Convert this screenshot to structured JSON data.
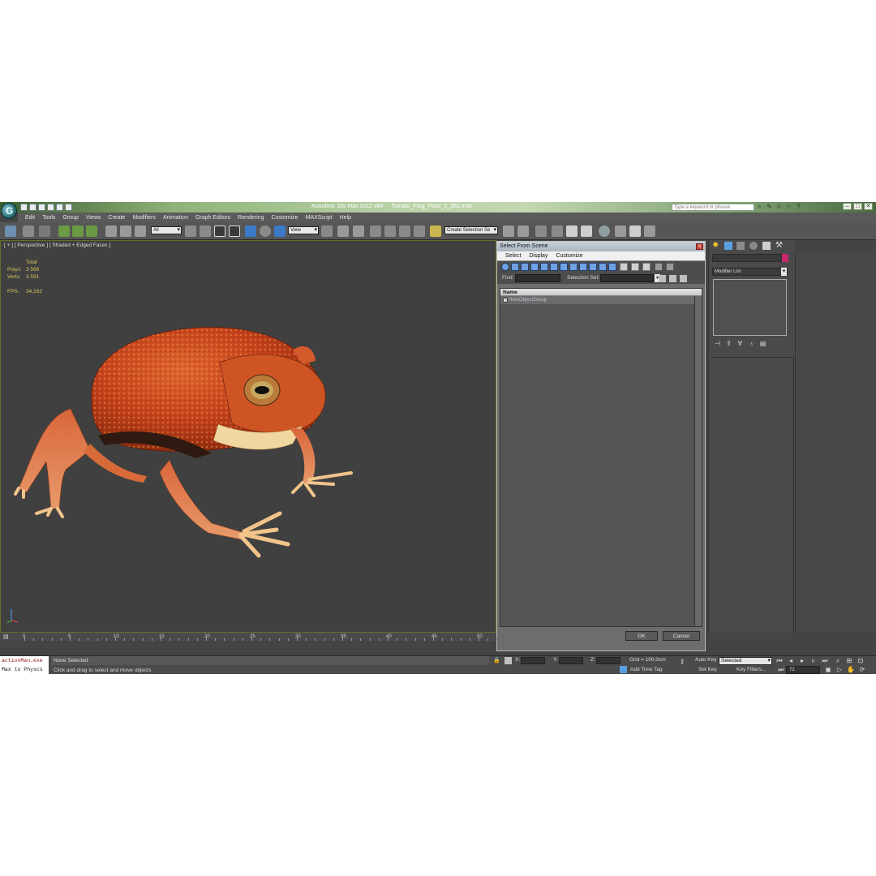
{
  "window": {
    "app_title": "Autodesk 3ds Max  2012 x64",
    "file_name": "Tomato_Frog_Pose_2_361.max",
    "search_placeholder": "Type a keyword or phrase",
    "controls": [
      "–",
      "□",
      "✕"
    ],
    "title_icons": [
      "binoculars-icon",
      "wrench-icon",
      "star-icon",
      "help-icon"
    ]
  },
  "menu": [
    "Edit",
    "Tools",
    "Group",
    "Views",
    "Create",
    "Modifiers",
    "Animation",
    "Graph Editors",
    "Rendering",
    "Customize",
    "MAXScript",
    "Help"
  ],
  "toolbar": {
    "filter_value": "All",
    "ref_coord_value": "View",
    "selection_set_value": "Create Selection Se"
  },
  "viewport": {
    "label": "[ + ] [ Perspective ] [ Shaded + Edged Faces ]",
    "stats": {
      "total_label": "Total",
      "polys_label": "Polys:",
      "polys_value": "3 566",
      "verts_label": "Verts:",
      "verts_value": "3 591",
      "fps_label": "FPS:",
      "fps_value": "34,162"
    }
  },
  "dialog": {
    "title": "Select From Scene",
    "close": "x",
    "menus": [
      "Select",
      "Display",
      "Customize"
    ],
    "find_label": "Find:",
    "selection_set_label": "Selection Set:",
    "column_name": "Name",
    "items": [
      "HeroObjectGroup"
    ],
    "ok_label": "OK",
    "cancel_label": "Cancel"
  },
  "command_panel": {
    "modifier_list": "Modifier List",
    "color_swatch": "#c7276d"
  },
  "timeline": {
    "ticks": [
      0,
      5,
      10,
      15,
      20,
      25,
      30,
      35,
      40,
      45,
      50
    ]
  },
  "status": {
    "listener_line1": "actionMan.exe",
    "listener_line2": "Max to Physcs",
    "selection": "None Selected",
    "prompt": "Click and drag to select and move objects",
    "x_label": "X:",
    "y_label": "Y:",
    "z_label": "Z:",
    "grid": "Grid = 100,0cm",
    "add_time_tag": "Add Time Tag",
    "auto_key": "Auto Key",
    "set_key": "Set Key",
    "selected_value": "Selected",
    "key_filters": "Key Filters...",
    "frame_value": "72"
  }
}
